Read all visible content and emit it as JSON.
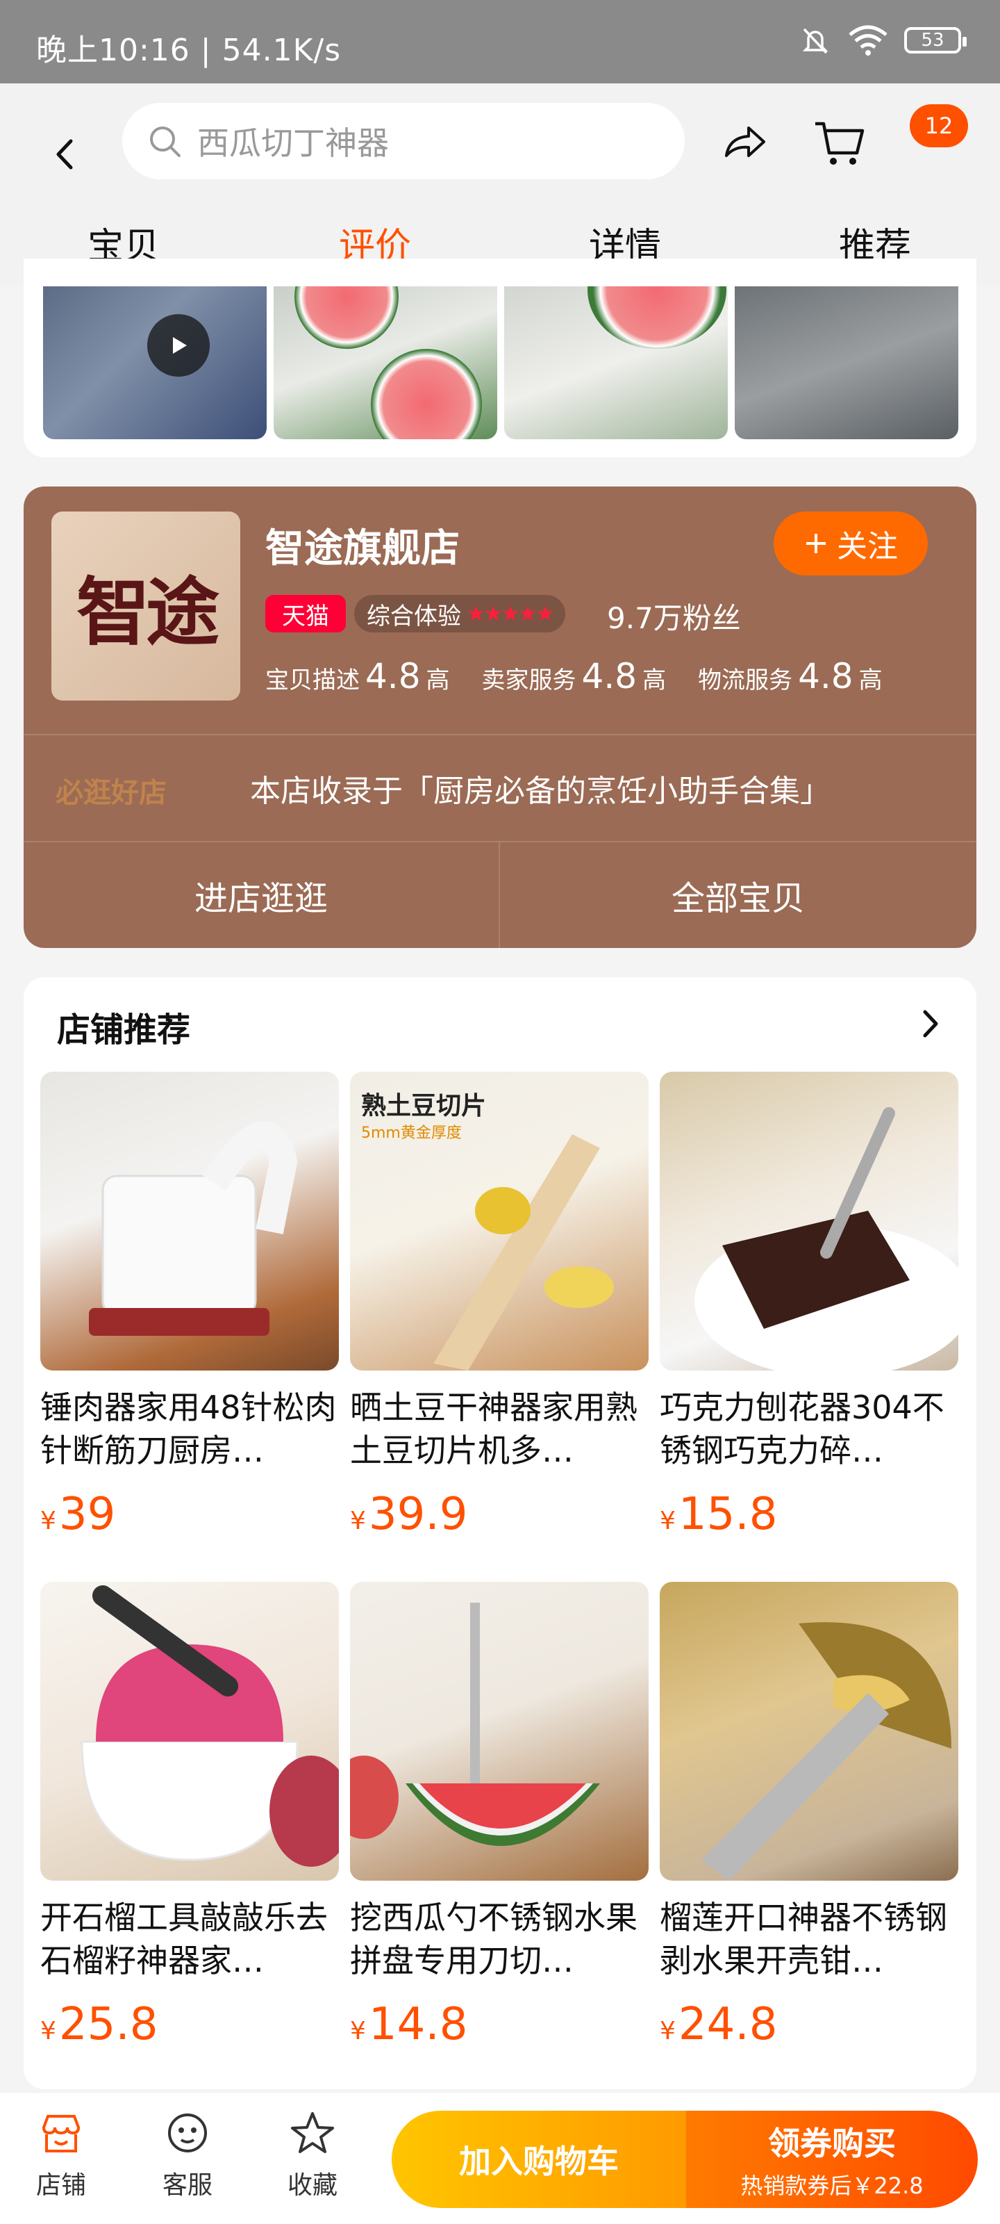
{
  "status_bar": {
    "time": "晚上10:16 | 54.1K/s",
    "battery": "53"
  },
  "header": {
    "search_placeholder": "西瓜切丁神器",
    "cart_badge": "12",
    "tabs": [
      {
        "label": "宝贝"
      },
      {
        "label": "评价"
      },
      {
        "label": "详情"
      },
      {
        "label": "推荐"
      }
    ],
    "active_tab": "评价"
  },
  "store": {
    "logo_text": "智途",
    "name": "智途旗舰店",
    "follow_label": "关注",
    "tmall_label": "天猫",
    "experience_label": "综合体验",
    "stars": "★★★★★",
    "fans": "9.7万粉丝",
    "ratings": [
      {
        "label": "宝贝描述",
        "score": "4.8",
        "level": "高"
      },
      {
        "label": "卖家服务",
        "score": "4.8",
        "level": "高"
      },
      {
        "label": "物流服务",
        "score": "4.8",
        "level": "高"
      }
    ],
    "ribbon_tag": "必逛好店",
    "collection_text": "本店收录于「厨房必备的烹饪小助手合集」",
    "visit_label": "进店逛逛",
    "all_items_label": "全部宝贝"
  },
  "recommend": {
    "title": "店铺推荐",
    "products": [
      {
        "title": "锤肉器家用48针松肉针断筋刀厨房…",
        "price": "39",
        "img_caption": ""
      },
      {
        "title": "晒土豆干神器家用熟土豆切片机多…",
        "price": "39.9",
        "img_caption": "熟土豆切片",
        "img_sub": "5mm黄金厚度"
      },
      {
        "title": "巧克力刨花器304不锈钢巧克力碎…",
        "price": "15.8",
        "img_caption": ""
      },
      {
        "title": "开石榴工具敲敲乐去石榴籽神器家…",
        "price": "25.8",
        "img_caption": ""
      },
      {
        "title": "挖西瓜勺不锈钢水果拼盘专用刀切…",
        "price": "14.8",
        "img_caption": ""
      },
      {
        "title": "榴莲开口神器不锈钢剥水果开壳钳…",
        "price": "24.8",
        "img_caption": ""
      }
    ],
    "currency": "¥"
  },
  "bottom_bar": {
    "shop_label": "店铺",
    "service_label": "客服",
    "favorite_label": "收藏",
    "add_cart_label": "加入购物车",
    "buy_label": "领券购买",
    "buy_sub": "热销款券后￥22.8"
  },
  "colors": {
    "accent": "#ff5000",
    "store_bg": "#9b6b55",
    "tmall": "#ff0036"
  }
}
